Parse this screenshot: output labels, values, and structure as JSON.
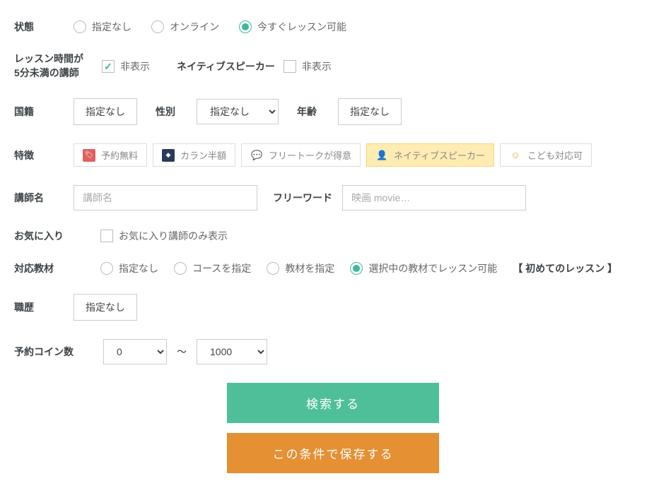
{
  "status": {
    "label": "状態",
    "options": [
      "指定なし",
      "オンライン",
      "今すぐレッスン可能"
    ],
    "selected": 2
  },
  "shortLesson": {
    "label": "レッスン時間が\n5分未満の講師",
    "hideLabel": "非表示",
    "checked": true
  },
  "nativeSpeaker": {
    "label": "ネイティブスピーカー",
    "hideLabel": "非表示",
    "checked": false
  },
  "nationality": {
    "label": "国籍",
    "value": "指定なし"
  },
  "gender": {
    "label": "性別",
    "value": "指定なし"
  },
  "age": {
    "label": "年齢",
    "value": "指定なし"
  },
  "features": {
    "label": "特徴",
    "tags": [
      {
        "text": "予約無料",
        "iconType": "tag"
      },
      {
        "text": "カラン半額",
        "iconType": "callan"
      },
      {
        "text": "フリートークが得意",
        "iconType": "chat"
      },
      {
        "text": "ネイティブスピーカー",
        "iconType": "native",
        "selected": true
      },
      {
        "text": "こども対応可",
        "iconType": "kids"
      }
    ]
  },
  "teacherName": {
    "label": "講師名",
    "placeholder": "講師名"
  },
  "freeword": {
    "label": "フリーワード",
    "placeholder": "映画 movie…"
  },
  "favorite": {
    "label": "お気に入り",
    "optionLabel": "お気に入り講師のみ表示",
    "checked": false
  },
  "materials": {
    "label": "対応教材",
    "options": [
      "指定なし",
      "コースを指定",
      "教材を指定",
      "選択中の教材でレッスン可能"
    ],
    "selected": 3,
    "currentMaterial": "【 初めてのレッスン 】"
  },
  "career": {
    "label": "職歴",
    "value": "指定なし"
  },
  "coins": {
    "label": "予約コイン数",
    "from": "0",
    "to": "1000"
  },
  "buttons": {
    "search": "検索する",
    "save": "この条件で保存する"
  }
}
